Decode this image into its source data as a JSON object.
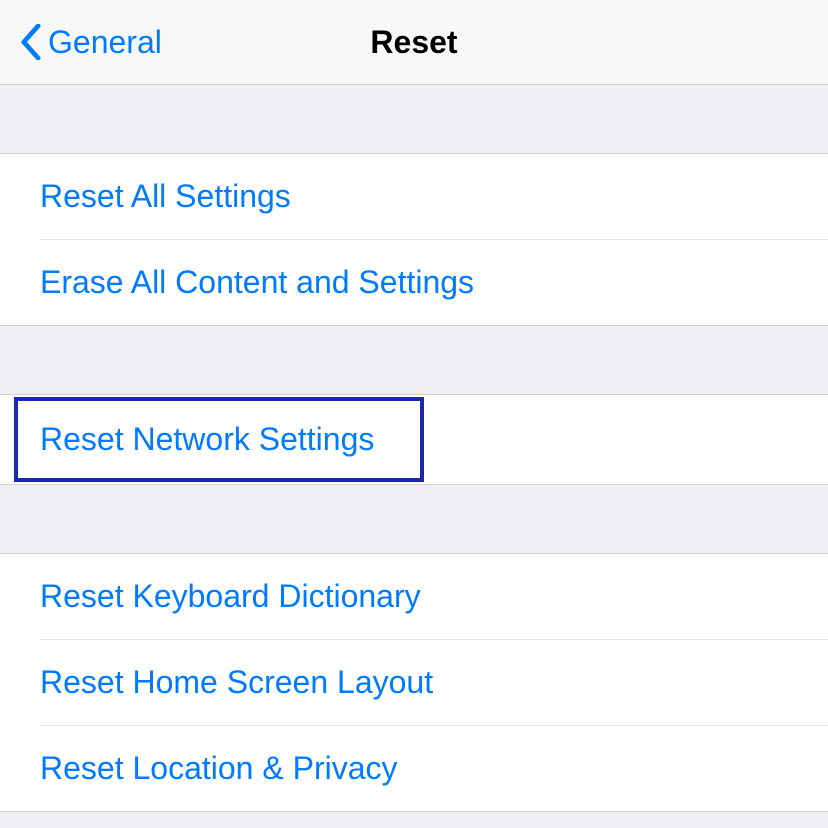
{
  "nav": {
    "back_label": "General",
    "title": "Reset"
  },
  "sections": [
    {
      "items": [
        {
          "label": "Reset All Settings"
        },
        {
          "label": "Erase All Content and Settings"
        }
      ]
    },
    {
      "items": [
        {
          "label": "Reset Network Settings",
          "highlighted": true
        }
      ]
    },
    {
      "items": [
        {
          "label": "Reset Keyboard Dictionary"
        },
        {
          "label": "Reset Home Screen Layout"
        },
        {
          "label": "Reset Location & Privacy"
        }
      ]
    }
  ]
}
